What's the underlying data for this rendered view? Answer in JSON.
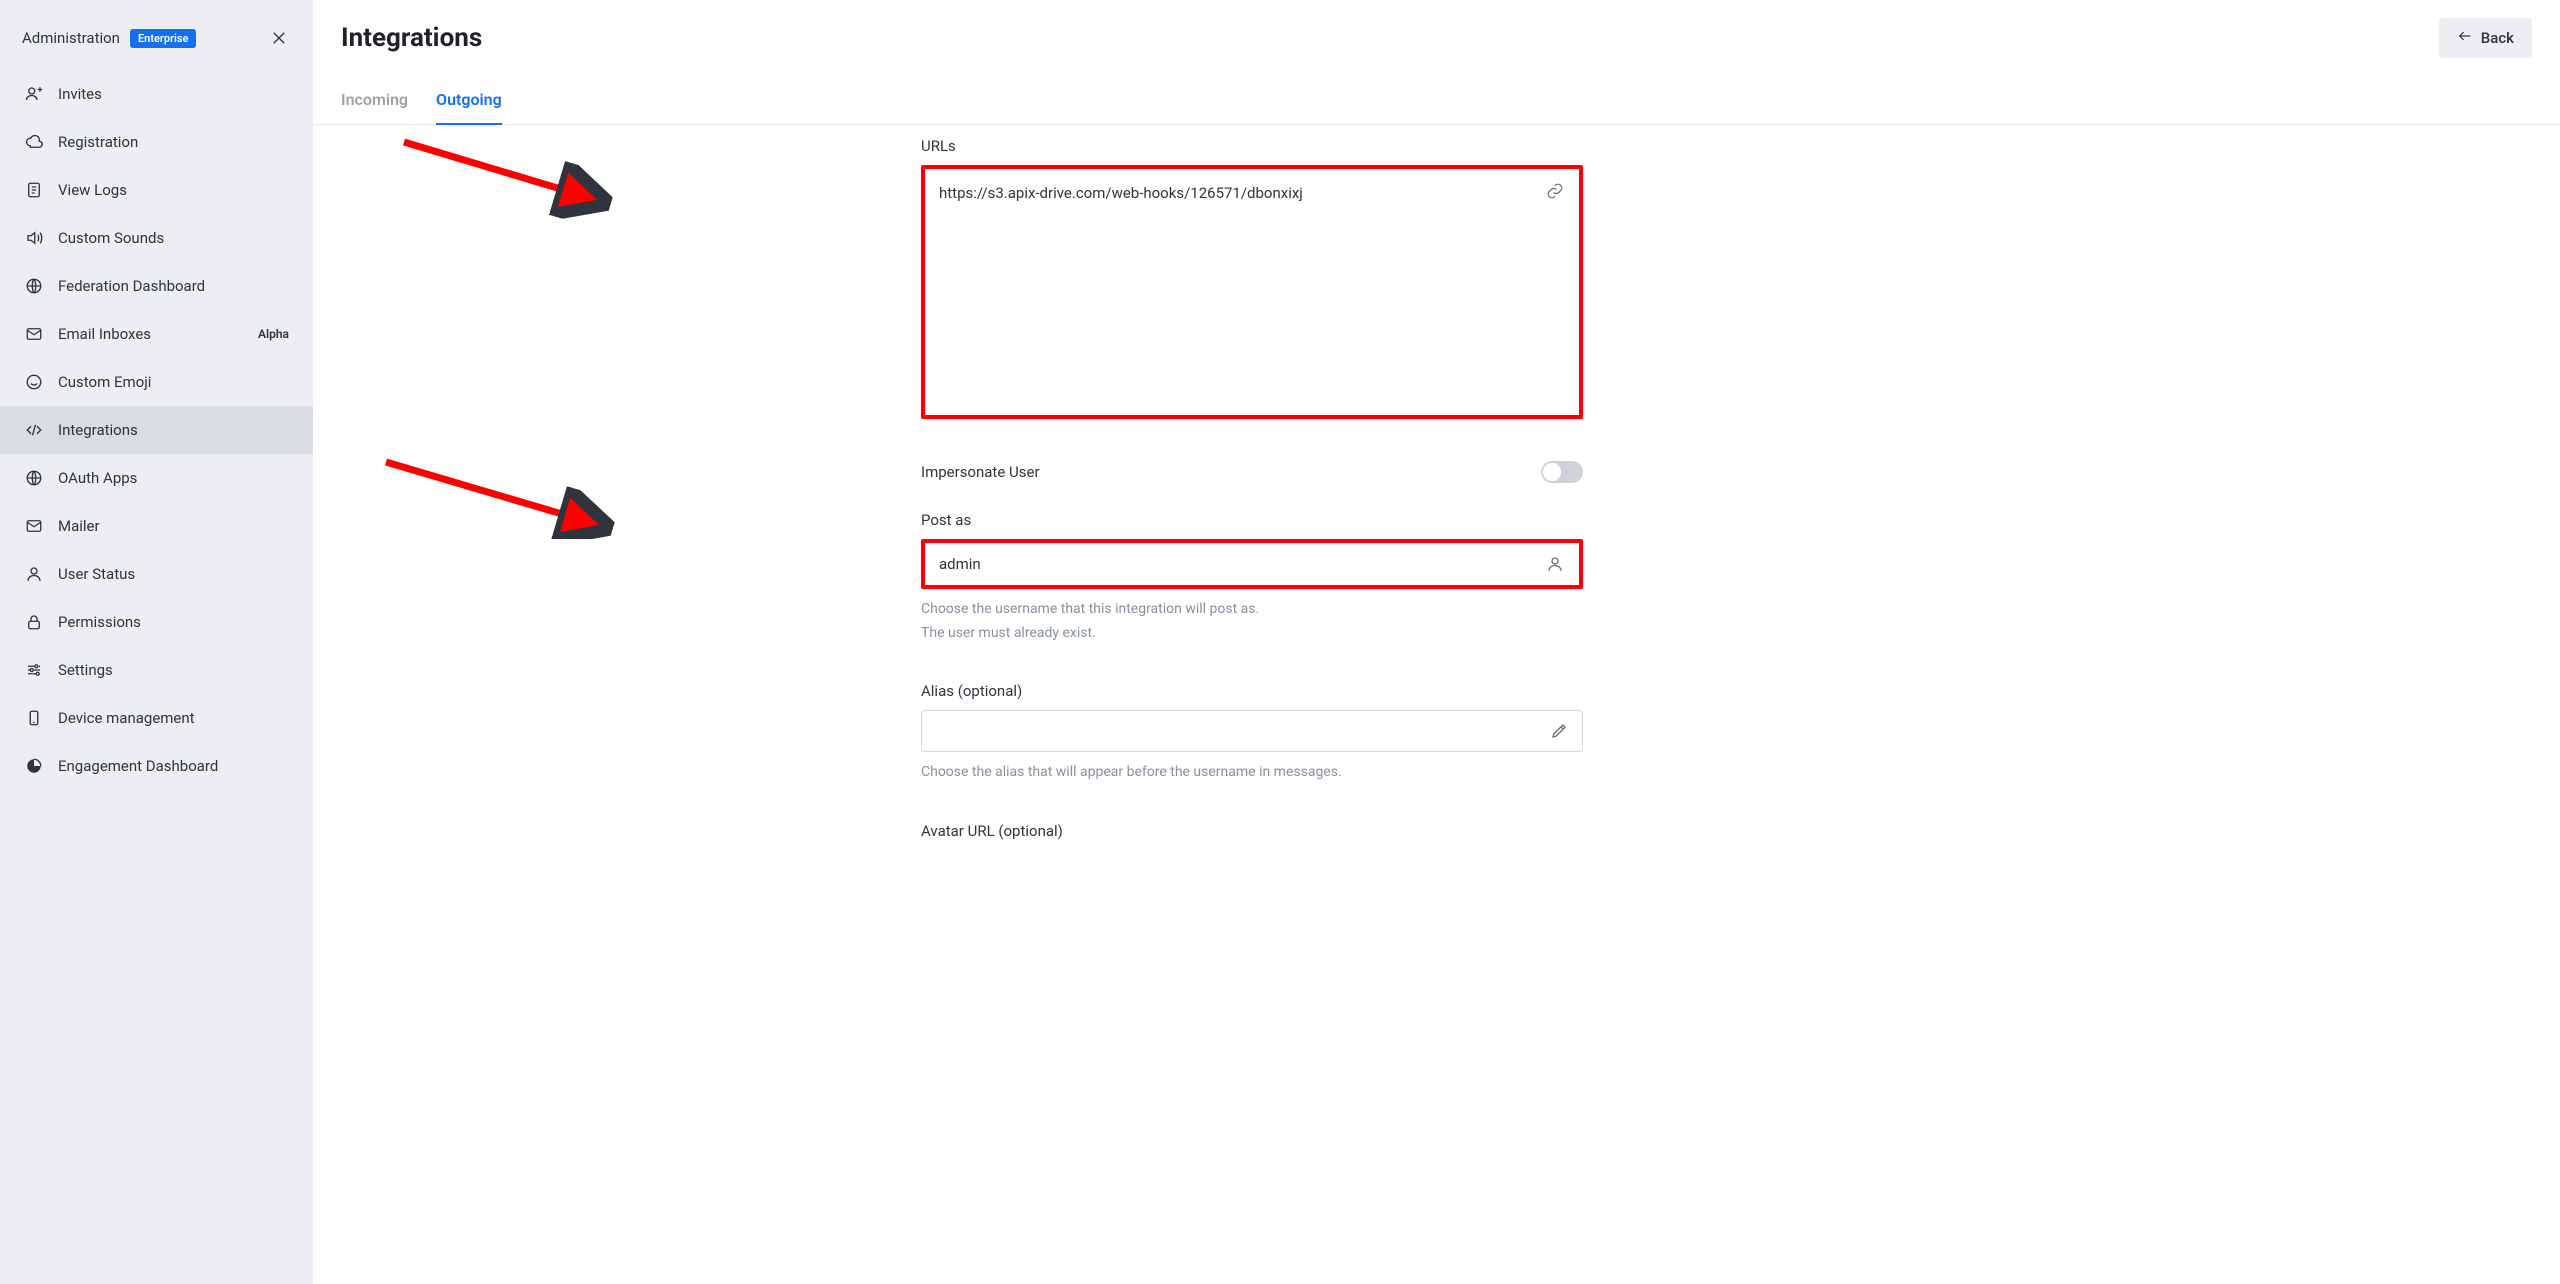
{
  "sidebar": {
    "title": "Administration",
    "badge": "Enterprise",
    "items": [
      {
        "label": "Invites",
        "icon": "user-plus-icon"
      },
      {
        "label": "Registration",
        "icon": "cloud-icon"
      },
      {
        "label": "View Logs",
        "icon": "log-icon"
      },
      {
        "label": "Custom Sounds",
        "icon": "sound-icon"
      },
      {
        "label": "Federation Dashboard",
        "icon": "globe-icon"
      },
      {
        "label": "Email Inboxes",
        "icon": "mail-icon",
        "pill": "Alpha"
      },
      {
        "label": "Custom Emoji",
        "icon": "emoji-icon"
      },
      {
        "label": "Integrations",
        "icon": "code-icon",
        "active": true
      },
      {
        "label": "OAuth Apps",
        "icon": "globe-icon"
      },
      {
        "label": "Mailer",
        "icon": "mail-icon"
      },
      {
        "label": "User Status",
        "icon": "user-icon"
      },
      {
        "label": "Permissions",
        "icon": "lock-icon"
      },
      {
        "label": "Settings",
        "icon": "sliders-icon"
      },
      {
        "label": "Device management",
        "icon": "device-icon"
      },
      {
        "label": "Engagement Dashboard",
        "icon": "pie-icon"
      }
    ]
  },
  "header": {
    "title": "Integrations",
    "back_label": "Back"
  },
  "tabs": [
    {
      "label": "Incoming",
      "active": false
    },
    {
      "label": "Outgoing",
      "active": true
    }
  ],
  "form": {
    "urls_label": "URLs",
    "urls_value": "https://s3.apix-drive.com/web-hooks/126571/dbonxixj",
    "impersonate_label": "Impersonate User",
    "impersonate_on": false,
    "post_as_label": "Post as",
    "post_as_value": "admin",
    "post_as_hint1": "Choose the username that this integration will post as.",
    "post_as_hint2": "The user must already exist.",
    "alias_label": "Alias (optional)",
    "alias_value": "",
    "alias_hint": "Choose the alias that will appear before the username in messages.",
    "avatar_label": "Avatar URL (optional)"
  }
}
